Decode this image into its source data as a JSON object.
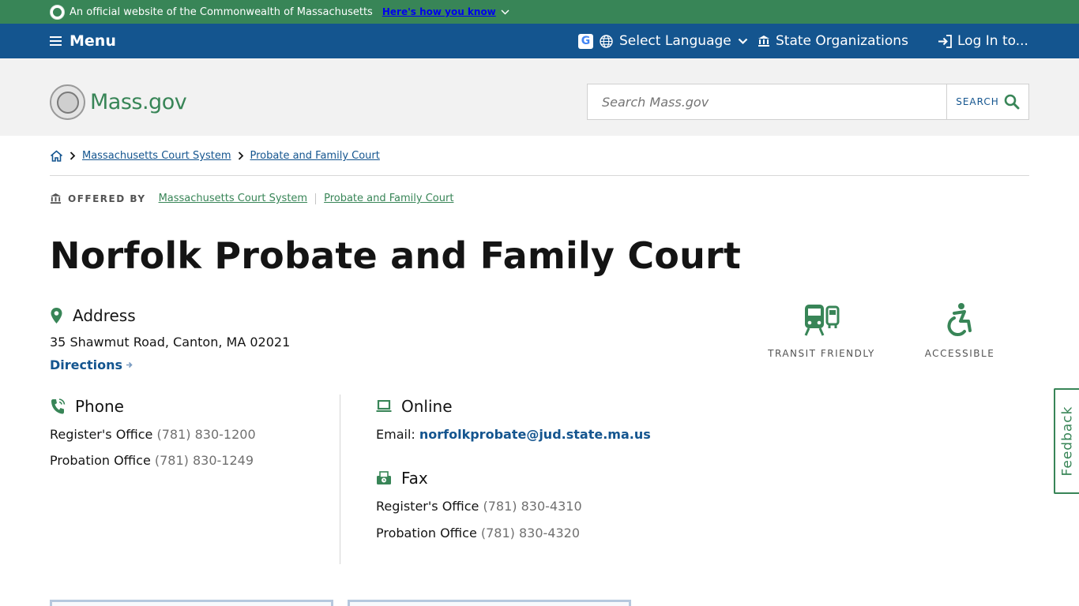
{
  "official_banner": {
    "text": "An official website of the Commonwealth of Massachusetts",
    "link": "Here's how you know"
  },
  "nav": {
    "menu_label": "Menu",
    "language_label": "Select Language",
    "orgs_label": "State Organizations",
    "login_label": "Log In to..."
  },
  "header": {
    "logo_text": "Mass.gov",
    "search_placeholder": "Search Mass.gov",
    "search_button": "SEARCH"
  },
  "breadcrumb": {
    "items": [
      "Massachusetts Court System",
      "Probate and Family Court"
    ]
  },
  "offered_by": {
    "label": "OFFERED BY",
    "orgs": [
      "Massachusetts Court System",
      "Probate and Family Court"
    ]
  },
  "page_title": "Norfolk Probate and Family Court",
  "address": {
    "heading": "Address",
    "line": "35 Shawmut Road, Canton, MA 02021",
    "directions": "Directions"
  },
  "amenities": [
    {
      "label": "TRANSIT FRIENDLY",
      "icon": "transit-icon"
    },
    {
      "label": "ACCESSIBLE",
      "icon": "accessible-icon"
    }
  ],
  "phone": {
    "heading": "Phone",
    "entries": [
      {
        "label": "Register's Office",
        "number": "(781) 830-1200"
      },
      {
        "label": "Probation Office",
        "number": "(781) 830-1249"
      }
    ]
  },
  "online": {
    "heading": "Online",
    "email_label": "Email:",
    "email": "norfolkprobate@jud.state.ma.us"
  },
  "fax": {
    "heading": "Fax",
    "entries": [
      {
        "label": "Register's Office",
        "number": "(781) 830-4310"
      },
      {
        "label": "Probation Office",
        "number": "(781) 830-4320"
      }
    ]
  },
  "feedback_label": "Feedback",
  "colors": {
    "green": "#388557",
    "blue": "#14558f",
    "header_gray": "#f2f2f2"
  }
}
